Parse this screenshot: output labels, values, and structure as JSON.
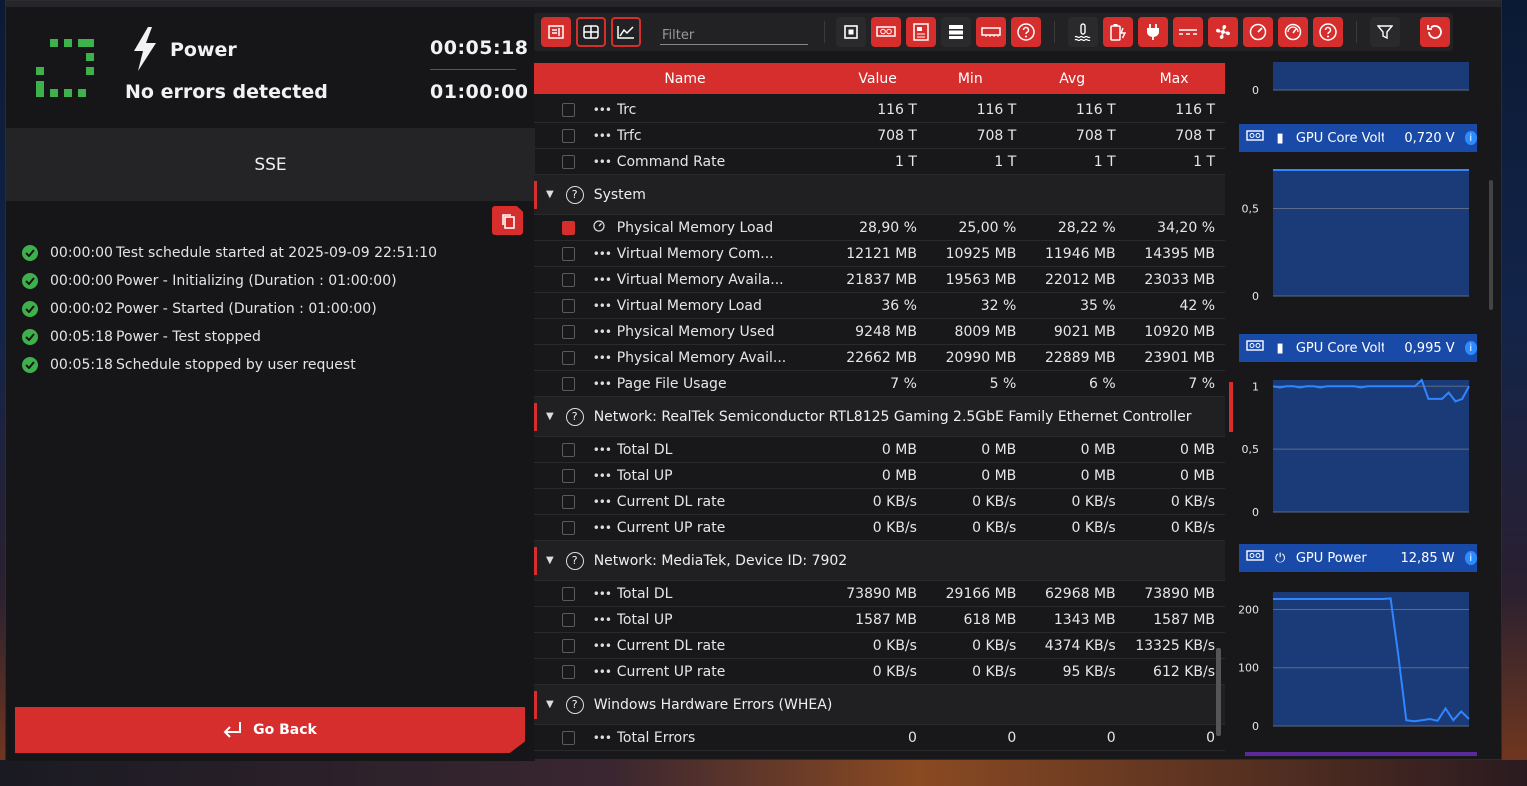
{
  "status": {
    "test_name": "Power",
    "result": "No errors detected",
    "elapsed": "00:05:18",
    "total": "01:00:00"
  },
  "profile": {
    "name": "SSE"
  },
  "log": [
    {
      "time": "00:00:00",
      "message": "Test schedule started at 2025-09-09 22:51:10"
    },
    {
      "time": "00:00:00",
      "message": "Power - Initializing (Duration : 01:00:00)"
    },
    {
      "time": "00:00:02",
      "message": "Power - Started (Duration : 01:00:00)"
    },
    {
      "time": "00:05:18",
      "message": "Power - Test stopped"
    },
    {
      "time": "00:05:18",
      "message": "Schedule stopped by user request"
    }
  ],
  "go_back_label": "Go Back",
  "toolbar": {
    "filter_placeholder": "Filter",
    "icons_left": [
      "sensor-list-icon",
      "table-view-icon",
      "graph-view-icon"
    ],
    "icons_right": [
      "cpu-icon",
      "gpu-icon",
      "motherboard-icon",
      "storage-icon",
      "memory-icon",
      "unknown-icon",
      "temperature-icon",
      "voltage-icon",
      "power-icon",
      "current-icon",
      "fan-icon",
      "clock-icon",
      "usage-icon",
      "other-icon",
      "filter-icon",
      "reset-icon"
    ]
  },
  "table": {
    "headers": {
      "name": "Name",
      "value": "Value",
      "min": "Min",
      "avg": "Avg",
      "max": "Max"
    },
    "rows": [
      {
        "kind": "item",
        "name": "Trc",
        "value": "116 T",
        "min": "116 T",
        "avg": "116 T",
        "max": "116 T",
        "checked": false,
        "icon": "dots"
      },
      {
        "kind": "item",
        "name": "Trfc",
        "value": "708 T",
        "min": "708 T",
        "avg": "708 T",
        "max": "708 T",
        "checked": false,
        "icon": "dots"
      },
      {
        "kind": "item",
        "name": "Command Rate",
        "value": "1 T",
        "min": "1 T",
        "avg": "1 T",
        "max": "1 T",
        "checked": false,
        "icon": "dots"
      },
      {
        "kind": "group",
        "name": "System"
      },
      {
        "kind": "item",
        "name": "Physical Memory Load",
        "value": "28,90 %",
        "min": "25,00 %",
        "avg": "28,22 %",
        "max": "34,20 %",
        "checked": true,
        "icon": "gauge"
      },
      {
        "kind": "item",
        "name": "Virtual Memory Com...",
        "value": "12121 MB",
        "min": "10925 MB",
        "avg": "11946 MB",
        "max": "14395 MB",
        "checked": false,
        "icon": "dots"
      },
      {
        "kind": "item",
        "name": "Virtual Memory Availa...",
        "value": "21837 MB",
        "min": "19563 MB",
        "avg": "22012 MB",
        "max": "23033 MB",
        "checked": false,
        "icon": "dots"
      },
      {
        "kind": "item",
        "name": "Virtual Memory Load",
        "value": "36 %",
        "min": "32 %",
        "avg": "35 %",
        "max": "42 %",
        "checked": false,
        "icon": "dots"
      },
      {
        "kind": "item",
        "name": "Physical Memory Used",
        "value": "9248 MB",
        "min": "8009 MB",
        "avg": "9021 MB",
        "max": "10920 MB",
        "checked": false,
        "icon": "dots"
      },
      {
        "kind": "item",
        "name": "Physical Memory Avail...",
        "value": "22662 MB",
        "min": "20990 MB",
        "avg": "22889 MB",
        "max": "23901 MB",
        "checked": false,
        "icon": "dots"
      },
      {
        "kind": "item",
        "name": "Page File Usage",
        "value": "7 %",
        "min": "5 %",
        "avg": "6 %",
        "max": "7 %",
        "checked": false,
        "icon": "dots"
      },
      {
        "kind": "group",
        "name": "Network: RealTek Semiconductor RTL8125 Gaming 2.5GbE Family Ethernet Controller"
      },
      {
        "kind": "item",
        "name": "Total DL",
        "value": "0 MB",
        "min": "0 MB",
        "avg": "0 MB",
        "max": "0 MB",
        "checked": false,
        "icon": "dots"
      },
      {
        "kind": "item",
        "name": "Total UP",
        "value": "0 MB",
        "min": "0 MB",
        "avg": "0 MB",
        "max": "0 MB",
        "checked": false,
        "icon": "dots"
      },
      {
        "kind": "item",
        "name": "Current DL rate",
        "value": "0 KB/s",
        "min": "0 KB/s",
        "avg": "0 KB/s",
        "max": "0 KB/s",
        "checked": false,
        "icon": "dots"
      },
      {
        "kind": "item",
        "name": "Current UP rate",
        "value": "0 KB/s",
        "min": "0 KB/s",
        "avg": "0 KB/s",
        "max": "0 KB/s",
        "checked": false,
        "icon": "dots"
      },
      {
        "kind": "group",
        "name": "Network: MediaTek, Device ID: 7902"
      },
      {
        "kind": "item",
        "name": "Total DL",
        "value": "73890 MB",
        "min": "29166 MB",
        "avg": "62968 MB",
        "max": "73890 MB",
        "checked": false,
        "icon": "dots"
      },
      {
        "kind": "item",
        "name": "Total UP",
        "value": "1587 MB",
        "min": "618 MB",
        "avg": "1343 MB",
        "max": "1587 MB",
        "checked": false,
        "icon": "dots"
      },
      {
        "kind": "item",
        "name": "Current DL rate",
        "value": "0 KB/s",
        "min": "0 KB/s",
        "avg": "4374 KB/s",
        "max": "13325 KB/s",
        "checked": false,
        "icon": "dots"
      },
      {
        "kind": "item",
        "name": "Current UP rate",
        "value": "0 KB/s",
        "min": "0 KB/s",
        "avg": "95 KB/s",
        "max": "612 KB/s",
        "checked": false,
        "icon": "dots"
      },
      {
        "kind": "group",
        "name": "Windows Hardware Errors (WHEA)"
      },
      {
        "kind": "item",
        "name": "Total Errors",
        "value": "0",
        "min": "0",
        "avg": "0",
        "max": "0",
        "checked": false,
        "icon": "dots"
      }
    ]
  },
  "charts": [
    {
      "title": "",
      "value": "",
      "ylabels": [
        "0"
      ],
      "yticks": [
        0
      ],
      "ylim": [
        0,
        1
      ],
      "series": []
    },
    {
      "title": "GPU Core Volta",
      "value": "0,720 V",
      "icon": "gpu-voltage-icon",
      "ylabels": [
        "0,5",
        "0"
      ],
      "yticks": [
        0.5,
        0
      ],
      "ylim": [
        0,
        0.72
      ],
      "series": [
        0.72,
        0.72,
        0.72,
        0.72,
        0.72,
        0.72,
        0.72,
        0.72
      ]
    },
    {
      "title": "GPU Core Volta",
      "value": "0,995 V",
      "icon": "gpu-voltage-icon",
      "ylabels": [
        "1",
        "0,5",
        "0"
      ],
      "yticks": [
        1,
        0.5,
        0
      ],
      "ylim": [
        0,
        1.05
      ],
      "series": [
        1.0,
        0.99,
        1.0,
        1.0,
        0.99,
        1.0,
        1.0,
        0.99,
        1.0,
        1.0,
        1.0,
        1.0,
        1.0,
        0.99,
        1.0,
        1.0,
        1.0,
        1.0,
        1.0,
        1.0,
        1.0,
        1.0,
        1.05,
        0.9,
        0.9,
        0.9,
        0.95,
        0.88,
        0.9,
        1.0
      ]
    },
    {
      "title": "GPU Power",
      "value": "12,85 W",
      "icon": "gpu-power-icon",
      "ylabels": [
        "200",
        "100",
        "0"
      ],
      "yticks": [
        200,
        100,
        0
      ],
      "ylim": [
        0,
        230
      ],
      "series": [
        218,
        218,
        218,
        218,
        218,
        218,
        218,
        218,
        218,
        218,
        218,
        218,
        218,
        218,
        218,
        219,
        120,
        10,
        8,
        10,
        12,
        9,
        30,
        10,
        25,
        12
      ]
    }
  ],
  "colors": {
    "accent": "#d62d2d",
    "ok": "#3db24a",
    "chart_blue": "#1a4aa8",
    "chart_line": "#2f86ff"
  }
}
